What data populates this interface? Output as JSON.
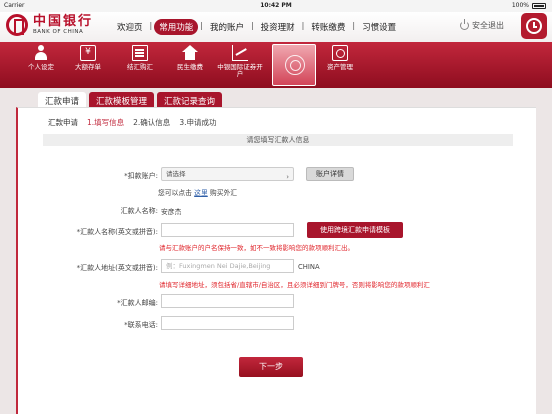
{
  "status_bar": {
    "carrier": "Carrier",
    "time": "10:42 PM",
    "battery": "100%"
  },
  "brand": {
    "name_cn": "中国银行",
    "name_en": "BANK OF CHINA"
  },
  "top_nav": {
    "items": [
      "欢迎页",
      "常用功能",
      "我的账户",
      "投资理财",
      "转账缴费",
      "习惯设置"
    ],
    "active_index": 1
  },
  "logout_label": "安全退出",
  "function_bar": {
    "items": [
      {
        "label": "个人设定",
        "icon": "person-icon"
      },
      {
        "label": "大额存单",
        "icon": "yuan-icon"
      },
      {
        "label": "结汇购汇",
        "icon": "document-icon"
      },
      {
        "label": "民生缴费",
        "icon": "house-icon"
      },
      {
        "label": "中银国际证券开户",
        "icon": "chart-icon"
      },
      {
        "label": "资产管理",
        "icon": "asset-icon"
      }
    ]
  },
  "tabs": [
    "汇款申请",
    "汇款模板管理",
    "汇款记录查询"
  ],
  "steps": {
    "title": "汇款申请",
    "s1": "1.填写信息",
    "s2": "2.确认信息",
    "s3": "3.申请成功"
  },
  "section_title": "请您填写汇款人信息",
  "form": {
    "debit_label": "*扣款账户:",
    "debit_placeholder": "请选择",
    "account_detail_btn": "账户详情",
    "hint_prefix": "您可以点击",
    "hint_link": "这里",
    "hint_suffix": "购买外汇",
    "remitter_name_label": "汇款人名称:",
    "remitter_name_value": "安彦杰",
    "remitter_en_name_label": "*汇款人名称(英文或拼音):",
    "use_template_btn": "使用跨境汇款申请模板",
    "name_note": "请与汇款账户的户名保持一致，如不一致将影响您的款项顺利汇出。",
    "address_label": "*汇款人地址(英文或拼音):",
    "address_placeholder": "例：Fuxingmen Nei Dajie,Beijing",
    "address_country": "CHINA",
    "address_note": "请填写详细地址，须包括省/直辖市/自治区，且必须详细到门牌号，否则将影响您的款项顺利汇",
    "zip_label": "*汇款人邮编:",
    "phone_label": "*联系电话:",
    "submit_label": "下一步"
  },
  "colors": {
    "brand_red": "#a8152c",
    "note_red": "#e0262c",
    "link_blue": "#2f5fa8"
  }
}
